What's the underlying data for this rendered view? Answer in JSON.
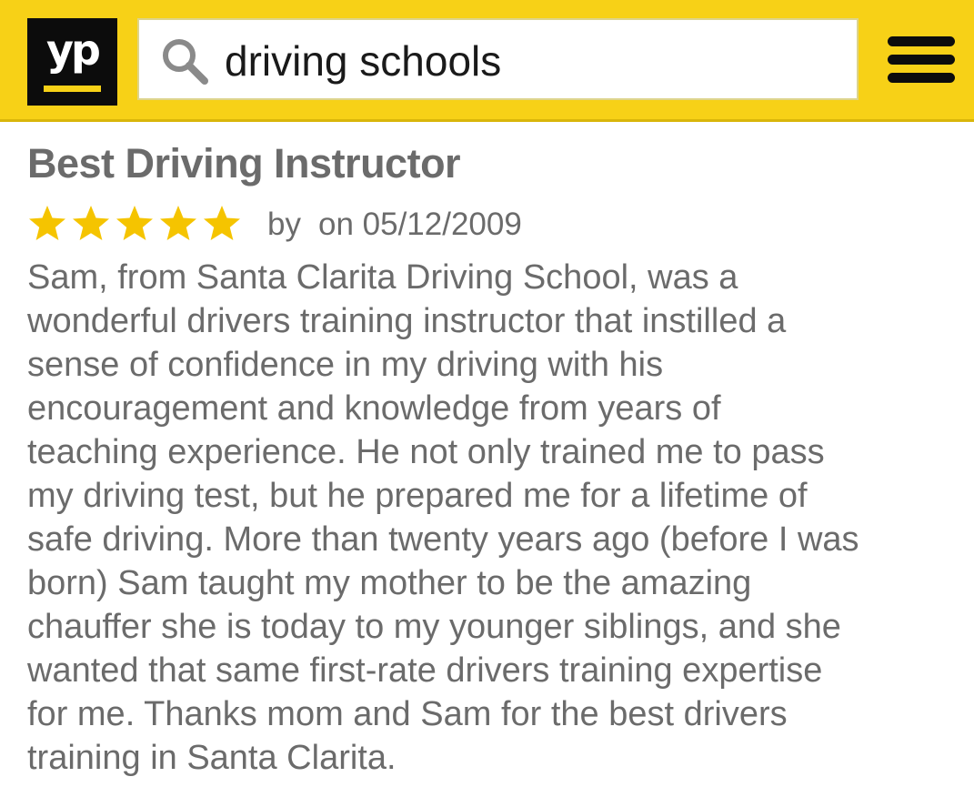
{
  "header": {
    "logo_text": "yp",
    "search": {
      "value": "driving schools"
    }
  },
  "colors": {
    "header_background": "#f7d117",
    "logo_background": "#0c0c0c",
    "star": "#f5c400",
    "text": "#6b6b6b"
  },
  "icons": {
    "logo": "yp-logo",
    "search": "search-icon",
    "menu": "menu-icon",
    "star": "star-icon"
  },
  "review": {
    "title": "Best Driving Instructor",
    "rating": 5,
    "rating_max": 5,
    "by_label": "by",
    "date_label": "on 05/12/2009",
    "body_lines": [
      "Sam, from Santa Clarita Driving School, was a",
      "wonderful drivers training instructor that instilled a",
      "sense of confidence in my driving with his",
      "encouragement and knowledge from years of",
      "teaching experience. He not only trained me to pass",
      "my driving test, but he prepared me for a lifetime of",
      "safe driving. More than twenty years ago (before I was",
      "born) Sam taught my mother to be the amazing",
      "chauffer she is today to my younger siblings, and she",
      "wanted that same first-rate drivers training expertise",
      "for me. Thanks mom and Sam for the best drivers",
      "training in Santa Clarita."
    ]
  }
}
